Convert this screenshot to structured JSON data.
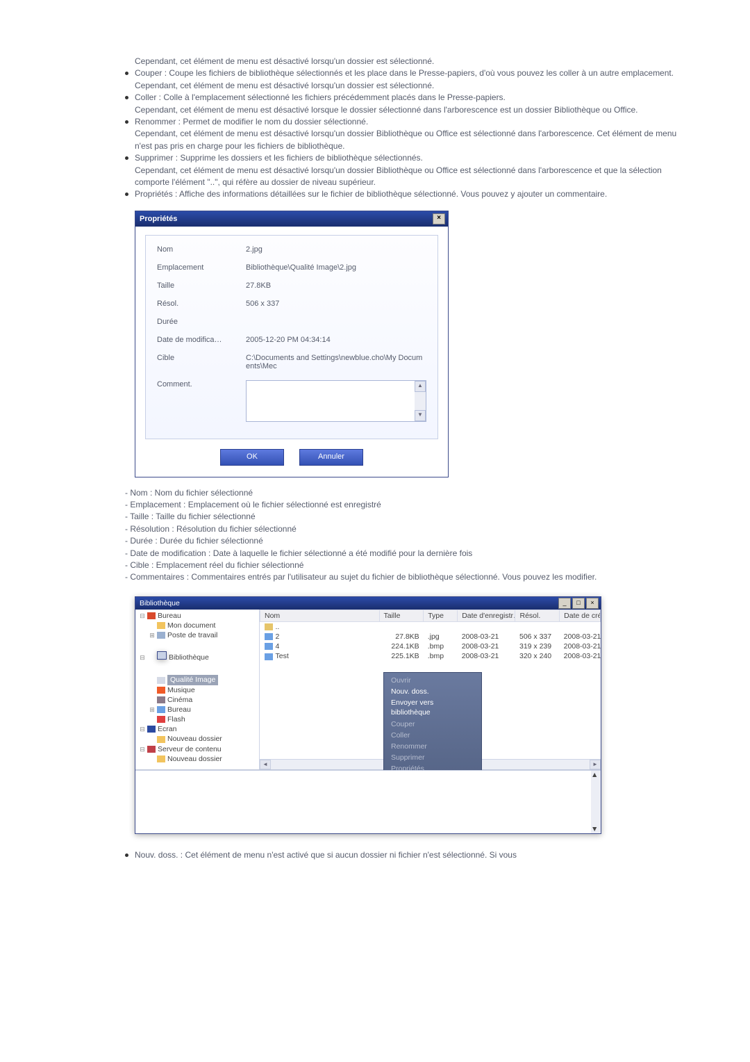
{
  "intro_line": "Cependant, cet élément de menu est désactivé lorsqu'un dossier est sélectionné.",
  "bullets_top": [
    {
      "main": "Couper : Coupe les fichiers de bibliothèque sélectionnés et les place dans le Presse-papiers, d'où vous pouvez les coller à un autre emplacement.",
      "sub": "Cependant, cet élément de menu est désactivé lorsqu'un dossier est sélectionné."
    },
    {
      "main": "Coller : Colle à l'emplacement sélectionné les fichiers précédemment placés dans le Presse-papiers.",
      "sub": "Cependant, cet élément de menu est désactivé lorsque le dossier sélectionné dans l'arborescence est un dossier Bibliothèque ou Office."
    },
    {
      "main": "Renommer : Permet de modifier le nom du dossier sélectionné.",
      "sub": "Cependant, cet élément de menu est désactivé lorsqu'un dossier Bibliothèque ou Office est sélectionné dans l'arborescence. Cet élément de menu n'est pas pris en charge pour les fichiers de bibliothèque."
    },
    {
      "main": "Supprimer : Supprime les dossiers et les fichiers de bibliothèque sélectionnés.",
      "sub": "Cependant, cet élément de menu est désactivé lorsqu'un dossier Bibliothèque ou Office est sélectionné dans l'arborescence et que la sélection comporte l'élément \"..\", qui réfère au dossier de niveau supérieur."
    },
    {
      "main": "Propriétés : Affiche des informations détaillées sur le fichier de bibliothèque sélectionné. Vous pouvez y ajouter un commentaire.",
      "sub": ""
    }
  ],
  "dlg": {
    "title": "Propriétés",
    "close_glyph": "×",
    "rows": {
      "nom": {
        "label": "Nom",
        "value": "2.jpg"
      },
      "emplacement": {
        "label": "Emplacement",
        "value": "Bibliothèque\\Qualité Image\\2.jpg"
      },
      "taille": {
        "label": "Taille",
        "value": "27.8KB"
      },
      "resol": {
        "label": "Résol.",
        "value": "506 x 337"
      },
      "duree": {
        "label": "Durée",
        "value": ""
      },
      "modif": {
        "label": "Date de modifica…",
        "value": "2005-12-20 PM 04:34:14"
      },
      "cible": {
        "label": "Cible",
        "value": "C:\\Documents and Settings\\newblue.cho\\My Documents\\Mec"
      },
      "comment": {
        "label": "Comment.",
        "value": ""
      }
    },
    "ok": "OK",
    "cancel": "Annuler"
  },
  "defs": [
    "- Nom : Nom du fichier sélectionné",
    "- Emplacement : Emplacement où le fichier sélectionné est enregistré",
    "- Taille : Taille du fichier sélectionné",
    "- Résolution : Résolution du fichier sélectionné",
    "- Durée : Durée du fichier sélectionné",
    "- Date de modification : Date à laquelle le fichier sélectionné a été modifié pour la dernière fois",
    "- Cible : Emplacement réel du fichier sélectionné",
    "- Commentaires : Commentaires entrés par l'utilisateur au sujet du fichier de bibliothèque sélectionné. Vous pouvez les modifier."
  ],
  "lib": {
    "title": "Bibliothèque",
    "win": {
      "min": "_",
      "max": "□",
      "close": "×"
    },
    "tree": [
      {
        "depth": 0,
        "toggle": "⊟",
        "icon": "desk",
        "label": "Bureau"
      },
      {
        "depth": 1,
        "toggle": "",
        "icon": "folder",
        "label": "Mon document"
      },
      {
        "depth": 1,
        "toggle": "⊞",
        "icon": "drive",
        "label": "Poste de travail"
      },
      {
        "depth": 0,
        "toggle": "⊟",
        "icon": "lib",
        "label": "Bibliothèque"
      },
      {
        "depth": 1,
        "toggle": "",
        "icon": "img",
        "label": "Qualité Image",
        "selected": true
      },
      {
        "depth": 1,
        "toggle": "",
        "icon": "music",
        "label": "Musique"
      },
      {
        "depth": 1,
        "toggle": "",
        "icon": "cinema",
        "label": "Cinéma"
      },
      {
        "depth": 1,
        "toggle": "⊞",
        "icon": "office",
        "label": "Bureau"
      },
      {
        "depth": 1,
        "toggle": "",
        "icon": "flash",
        "label": "Flash"
      },
      {
        "depth": 0,
        "toggle": "⊟",
        "icon": "screen",
        "label": "Ecran"
      },
      {
        "depth": 1,
        "toggle": "",
        "icon": "folder",
        "label": "Nouveau dossier"
      },
      {
        "depth": 0,
        "toggle": "⊟",
        "icon": "server",
        "label": "Serveur de contenu"
      },
      {
        "depth": 1,
        "toggle": "",
        "icon": "folder",
        "label": "Nouveau dossier"
      }
    ],
    "columns": {
      "nom": "Nom",
      "taille": "Taille",
      "type": "Type",
      "date": "Date d'enregistr…",
      "resol": "Résol.",
      "crea": "Date de créa"
    },
    "rows": [
      {
        "icon": "folder",
        "nom": "..",
        "taille": "",
        "type": "",
        "date": "",
        "resol": "",
        "crea": ""
      },
      {
        "icon": "pic",
        "nom": "2",
        "taille": "27.8KB",
        "type": ".jpg",
        "date": "2008-03-21",
        "resol": "506 x 337",
        "crea": "2008-03-21"
      },
      {
        "icon": "pic",
        "nom": "4",
        "taille": "224.1KB",
        "type": ".bmp",
        "date": "2008-03-21",
        "resol": "319 x 239",
        "crea": "2008-03-21"
      },
      {
        "icon": "pic",
        "nom": "Test",
        "taille": "225.1KB",
        "type": ".bmp",
        "date": "2008-03-21",
        "resol": "320 x 240",
        "crea": "2008-03-21"
      }
    ],
    "ctx": [
      {
        "label": "Ouvrir",
        "enabled": false
      },
      {
        "label": "Nouv. doss.",
        "enabled": true
      },
      {
        "label": "Envoyer vers bibliothèque",
        "enabled": true
      },
      {
        "label": "Couper",
        "enabled": false
      },
      {
        "label": "Coller",
        "enabled": false
      },
      {
        "label": "Renommer",
        "enabled": false
      },
      {
        "label": "Supprimer",
        "enabled": false
      },
      {
        "label": "Propriétés",
        "enabled": false
      }
    ],
    "arrow_left": "◄",
    "arrow_right": "►",
    "arrow_up": "▲",
    "arrow_down": "▼"
  },
  "final_bullet": "Nouv. doss. : Cet élément de menu n'est activé que si aucun dossier ni fichier n'est sélectionné. Si vous"
}
